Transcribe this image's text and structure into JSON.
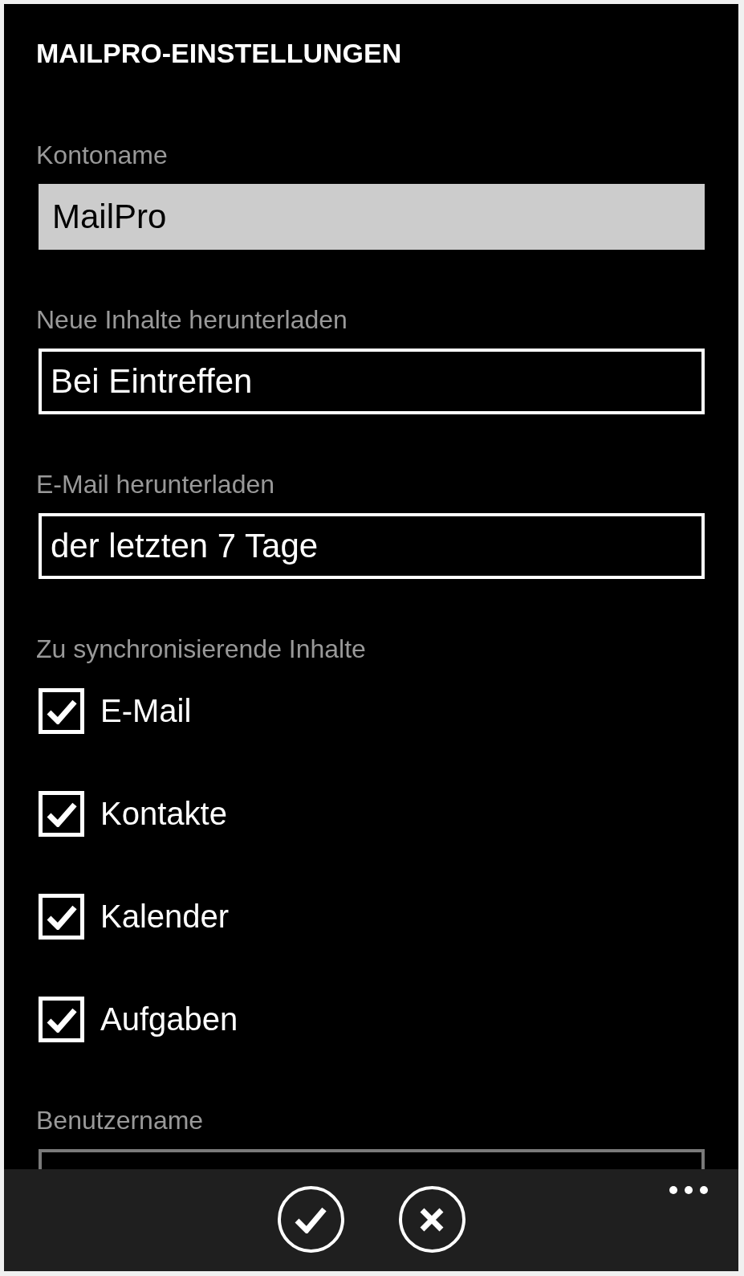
{
  "header": {
    "title": "MAILPRO-EINSTELLUNGEN"
  },
  "fields": [
    {
      "kind": "text",
      "label": "Kontoname",
      "value": "MailPro"
    },
    {
      "kind": "select",
      "label": "Neue Inhalte herunterladen",
      "value": "Bei Eintreffen"
    },
    {
      "kind": "select",
      "label": "E-Mail herunterladen",
      "value": "der letzten 7 Tage"
    }
  ],
  "sync": {
    "label": "Zu synchronisierende Inhalte",
    "items": [
      {
        "label": "E-Mail",
        "checked": true
      },
      {
        "label": "Kontakte",
        "checked": true
      },
      {
        "label": "Kalender",
        "checked": true
      },
      {
        "label": "Aufgaben",
        "checked": true
      }
    ]
  },
  "username": {
    "label": "Benutzername",
    "disabled": true
  }
}
